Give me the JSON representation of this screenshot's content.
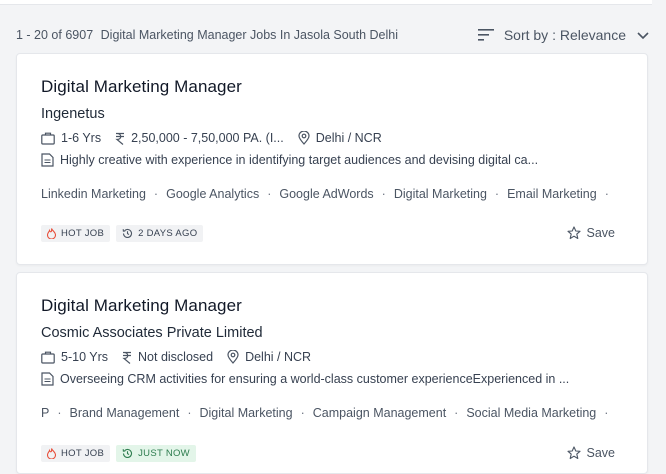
{
  "results": {
    "range": "1 - 20 of 6907",
    "query": "Digital Marketing Manager Jobs In Jasola South Delhi",
    "sort_label": "Sort by : Relevance"
  },
  "jobs": [
    {
      "title": "Digital Marketing Manager",
      "company": "Ingenetus",
      "experience": "1-6 Yrs",
      "salary": "2,50,000 - 7,50,000 PA. (I...",
      "location": "Delhi / NCR",
      "description": "Highly creative with experience in identifying target audiences and devising digital ca...",
      "skills": [
        "Linkedin Marketing",
        "Google Analytics",
        "Google AdWords",
        "Digital Marketing",
        "Email Marketing"
      ],
      "tags": [
        "HOT JOB",
        "2 DAYS AGO"
      ],
      "save_label": "Save"
    },
    {
      "title": "Digital Marketing Manager",
      "company": "Cosmic Associates Private Limited",
      "experience": "5-10 Yrs",
      "salary": "Not disclosed",
      "location": "Delhi / NCR",
      "description": "Overseeing CRM activities for ensuring a world-class customer experienceExperienced in ...",
      "skills": [
        "P",
        "Brand Management",
        "Digital Marketing",
        "Campaign Management",
        "Social Media Marketing"
      ],
      "tags": [
        "HOT JOB",
        "JUST NOW"
      ],
      "save_label": "Save"
    }
  ],
  "icons": {
    "sort": "sort-lines-icon",
    "chevron": "chevron-down-icon",
    "experience": "briefcase-icon",
    "salary": "rupee-icon",
    "location": "location-pin-icon",
    "description": "document-icon",
    "hot": "flame-icon",
    "time": "history-clock-icon",
    "save": "star-outline-icon"
  },
  "colors": {
    "hot_icon": "#e8513d",
    "fresh_bg": "#e3f5e9",
    "fresh_text": "#2e7d4f"
  }
}
